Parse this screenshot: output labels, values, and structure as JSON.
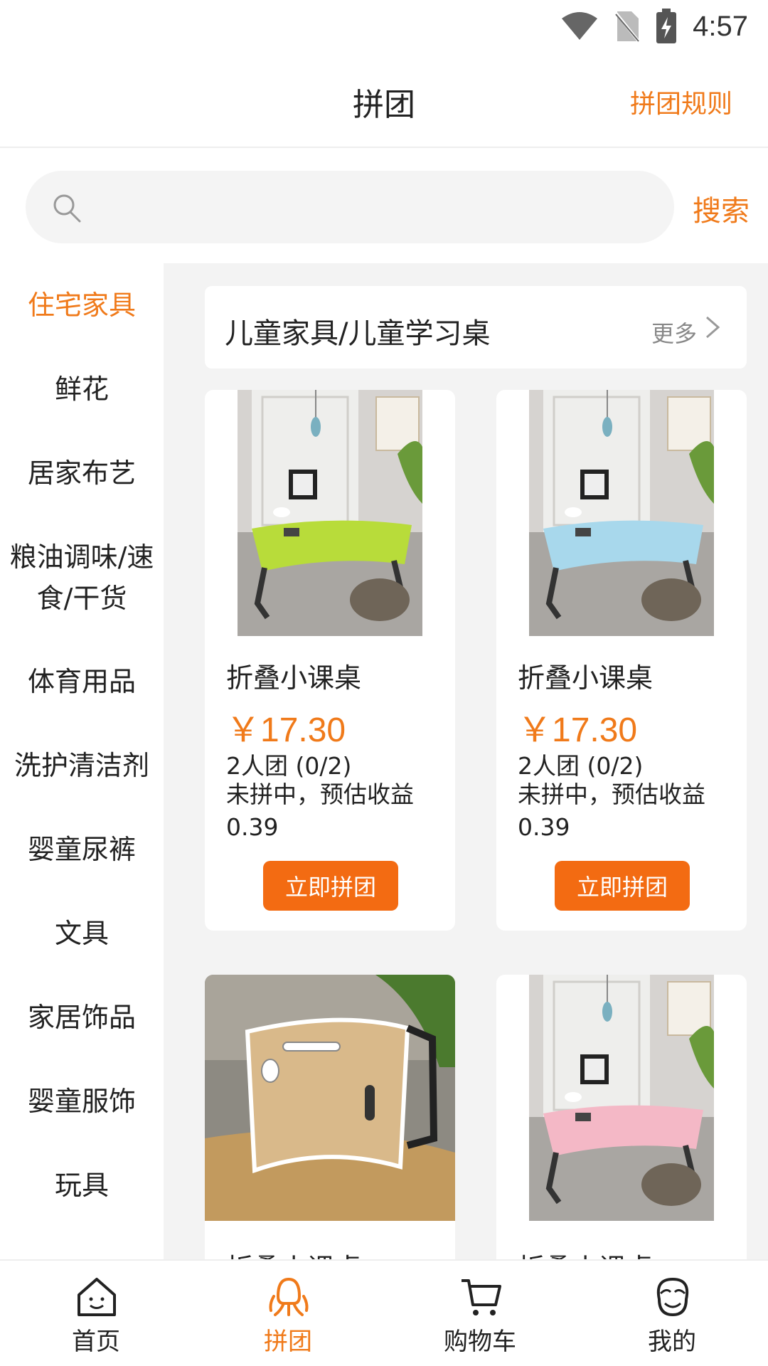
{
  "status_bar": {
    "time": "4:57"
  },
  "header": {
    "title": "拼团",
    "rules_link": "拼团规则"
  },
  "search": {
    "placeholder": "",
    "button": "搜索"
  },
  "sidebar": {
    "categories": [
      {
        "label": "住宅家具",
        "active": true
      },
      {
        "label": "鲜花"
      },
      {
        "label": "居家布艺"
      },
      {
        "label": "粮油调味/速食/干货"
      },
      {
        "label": "体育用品"
      },
      {
        "label": "洗护清洁剂"
      },
      {
        "label": "婴童尿裤"
      },
      {
        "label": "文具"
      },
      {
        "label": "家居饰品"
      },
      {
        "label": "婴童服饰"
      },
      {
        "label": "玩具"
      }
    ]
  },
  "section": {
    "title": "儿童家具/儿童学习桌",
    "more": "更多"
  },
  "products": [
    {
      "name": "折叠小课桌",
      "price": "￥17.30",
      "group": "2人团 (0/2)",
      "status": "未拼中，预估收益0.39",
      "button": "立即拼团",
      "desk_color": "#b8dc3a"
    },
    {
      "name": "折叠小课桌",
      "price": "￥17.30",
      "group": "2人团 (0/2)",
      "status": "未拼中，预估收益0.39",
      "button": "立即拼团",
      "desk_color": "#a8d8ec"
    },
    {
      "name": "折叠小课桌",
      "desk_color": "#d9b98a"
    },
    {
      "name": "折叠小课桌",
      "desk_color": "#f4b8c6"
    }
  ],
  "bottom_nav": {
    "tabs": [
      {
        "label": "首页",
        "icon": "home-icon"
      },
      {
        "label": "拼团",
        "icon": "group-icon",
        "active": true
      },
      {
        "label": "购物车",
        "icon": "cart-icon"
      },
      {
        "label": "我的",
        "icon": "profile-icon"
      }
    ]
  },
  "colors": {
    "accent": "#f07a1a",
    "button": "#f36b12"
  }
}
